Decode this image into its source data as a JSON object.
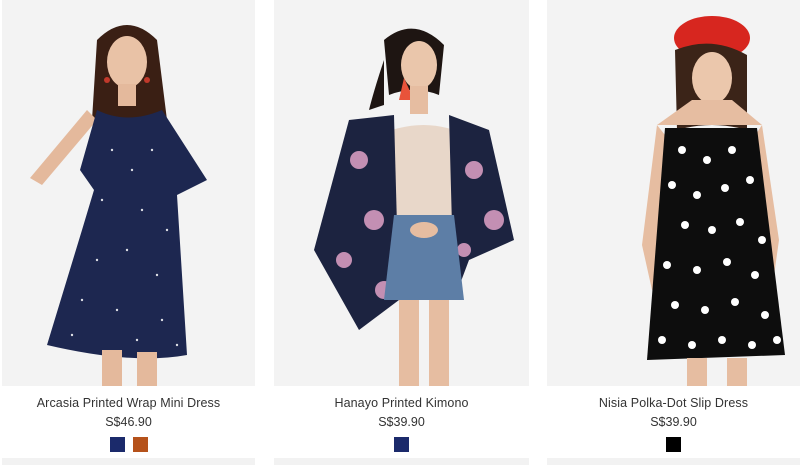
{
  "products": [
    {
      "name": "Arcasia Printed Wrap Mini Dress",
      "price": "S$46.90",
      "swatches": [
        "#1b2a6b",
        "#b5521b"
      ],
      "image_icon": "model-navy-printed-wrap-dress-photo"
    },
    {
      "name": "Hanayo Printed Kimono",
      "price": "S$39.90",
      "swatches": [
        "#1b2a6b"
      ],
      "image_icon": "model-floral-kimono-denim-skirt-photo"
    },
    {
      "name": "Nisia Polka-Dot Slip Dress",
      "price": "S$39.90",
      "swatches": [
        "#000000"
      ],
      "image_icon": "model-polka-dot-slip-dress-red-beret-photo"
    }
  ]
}
